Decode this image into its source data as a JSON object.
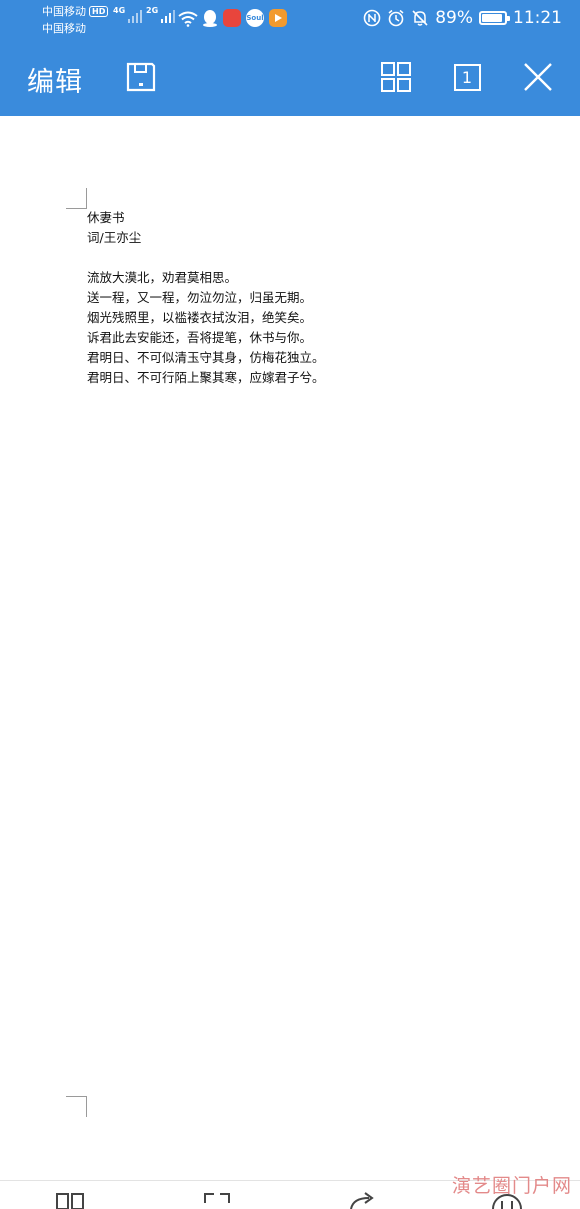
{
  "status_bar": {
    "carrier_1": "中国移动",
    "hd_badge": "HD",
    "carrier_2": "中国移动",
    "net_1": "4G",
    "net_2": "2G",
    "app_labels": [
      "",
      "",
      "",
      "Soul",
      ""
    ],
    "battery": "89%",
    "battery_level": 0.89,
    "time": "11:21"
  },
  "toolbar": {
    "title": "编辑",
    "page_number": "1"
  },
  "document": {
    "title": "休妻书",
    "author": "词/王亦尘",
    "lines": [
      "流放大漠北，劝君莫相思。",
      "送一程，又一程，勿泣勿泣，归虽无期。",
      "烟光残照里，以褴褛衣拭汝泪，绝笑矣。",
      "诉君此去安能还，吾将提笔，休书与你。",
      "君明日、不可似清玉守其身，仿梅花独立。",
      "君明日、不可行陌上聚其寒，应嫁君子兮。"
    ]
  },
  "watermark": "演艺圈门户网",
  "colors": {
    "header_blue": "#3a8bdc",
    "watermark": "#e38a8a"
  }
}
